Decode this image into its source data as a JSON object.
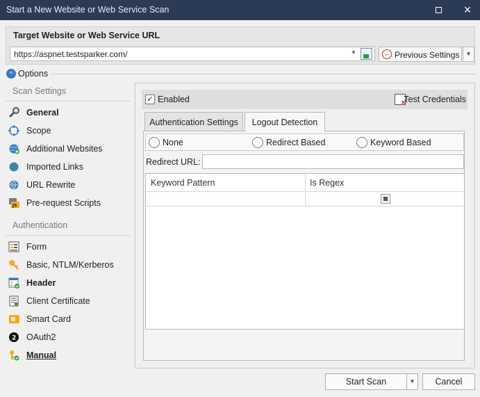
{
  "window": {
    "title": "Start a New Website or Web Service Scan",
    "maximize_glyph": "",
    "close_glyph": "×"
  },
  "target": {
    "header": "Target Website or Web Service URL",
    "url_value": "https://aspnet.testsparker.com/",
    "previous_settings_label": "Previous Settings"
  },
  "options": {
    "label": "Options"
  },
  "sidebar": {
    "scan_settings_title": "Scan Settings",
    "scan_settings_items": [
      {
        "label": "General",
        "icon": "wrench-icon"
      },
      {
        "label": "Scope",
        "icon": "target-icon"
      },
      {
        "label": "Additional Websites",
        "icon": "globe-plus-icon"
      },
      {
        "label": "Imported Links",
        "icon": "link-icon"
      },
      {
        "label": "URL Rewrite",
        "icon": "globe-icon"
      },
      {
        "label": "Pre-request Scripts",
        "icon": "js-script-icon"
      }
    ],
    "authentication_title": "Authentication",
    "authentication_items": [
      {
        "label": "Form",
        "icon": "form-icon"
      },
      {
        "label": "Basic, NTLM/Kerberos",
        "icon": "key-icon"
      },
      {
        "label": "Header",
        "icon": "header-icon"
      },
      {
        "label": "Client Certificate",
        "icon": "certificate-icon"
      },
      {
        "label": "Smart Card",
        "icon": "smart-card-icon"
      },
      {
        "label": "OAuth2",
        "icon": "oauth2-icon"
      },
      {
        "label": "Manual",
        "icon": "manual-icon"
      }
    ]
  },
  "auth_panel": {
    "enabled_label": "Enabled",
    "enabled_checked": true,
    "test_credentials_label": "Test Credentials",
    "tabs": [
      {
        "label": "Authentication Settings",
        "active": false
      },
      {
        "label": "Logout Detection",
        "active": true
      }
    ],
    "radios": [
      {
        "label": "None"
      },
      {
        "label": "Redirect Based"
      },
      {
        "label": "Keyword Based"
      }
    ],
    "redirect_url_label": "Redirect URL:",
    "redirect_url_value": "",
    "grid": {
      "columns": [
        "Keyword Pattern",
        "Is Regex"
      ],
      "rows": [
        {
          "keyword_pattern": "",
          "is_regex": "indeterminate"
        }
      ]
    }
  },
  "footer": {
    "start_scan_label": "Start Scan",
    "cancel_label": "Cancel"
  },
  "colors": {
    "titlebar": "#2b3a55",
    "accent": "#3c78c4",
    "danger": "#d32f2f",
    "green": "#2f9b3b"
  }
}
